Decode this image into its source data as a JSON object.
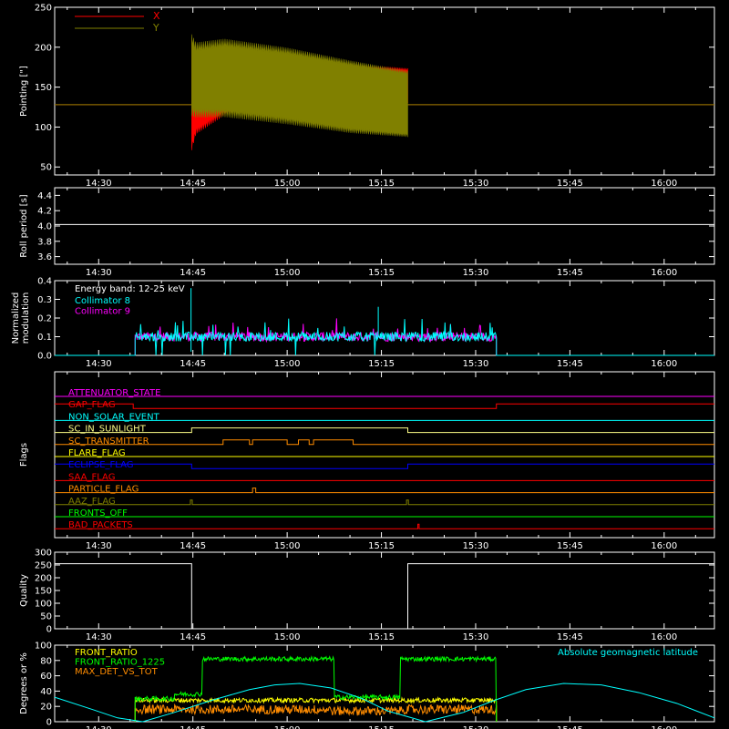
{
  "colors": {
    "bg": "#000000",
    "axis": "#ffffff",
    "x": "#ff0000",
    "y": "#808000",
    "collimator8": "#00ffff",
    "collimator9": "#ff00ff",
    "front_ratio": "#ffff00",
    "front_ratio_1225": "#00ff00",
    "max_det": "#ff8c00",
    "geomag": "#00ffff"
  },
  "time_ticks": [
    "14:30",
    "14:45",
    "15:00",
    "15:15",
    "15:30",
    "15:45",
    "16:00"
  ],
  "chart_data": [
    {
      "id": "pointing",
      "type": "area",
      "title": "",
      "xlabel": "",
      "ylabel": "Pointing [\"]",
      "xlim_min": [
        863,
        968
      ],
      "ylim": [
        40,
        250
      ],
      "yticks": [
        50,
        100,
        150,
        200,
        250
      ],
      "legend": "top-left",
      "series": [
        {
          "name": "X",
          "color": "#ff0000",
          "baseline": 128,
          "active_min": [
            884.8,
            919.2
          ],
          "envelope_min": [
            884.8,
            885.5,
            890,
            900,
            910,
            919.2
          ],
          "envelope_hi": [
            205,
            195,
            185,
            180,
            177,
            172
          ],
          "envelope_lo": [
            75,
            95,
            118,
            126,
            130,
            132
          ]
        },
        {
          "name": "Y",
          "color": "#808000",
          "baseline": 128,
          "active_min": [
            884.8,
            919.2
          ],
          "envelope_min": [
            884.8,
            885.5,
            890,
            900,
            910,
            919.2
          ],
          "envelope_hi": [
            210,
            200,
            205,
            195,
            180,
            168
          ],
          "envelope_lo": [
            120,
            118,
            118,
            108,
            96,
            90
          ]
        }
      ]
    },
    {
      "id": "roll",
      "type": "line",
      "ylabel": "Roll period [s]",
      "ylim": [
        3.5,
        4.5
      ],
      "yticks": [
        3.6,
        3.8,
        4.0,
        4.2,
        4.4
      ],
      "series": [
        {
          "name": "",
          "color": "#ffffff",
          "value": 4.02
        }
      ]
    },
    {
      "id": "modulation",
      "type": "line",
      "ylabel": "Normalized modulation",
      "ylim": [
        0,
        0.4
      ],
      "yticks": [
        0.0,
        0.1,
        0.2,
        0.3,
        0.4
      ],
      "annotation": "Energy band: 12-25 keV",
      "legend": "top-left",
      "active_min": [
        875.8,
        933.3
      ],
      "series": [
        {
          "name": "Collimator 8",
          "color": "#00ffff",
          "level": 0.1
        },
        {
          "name": "Collimator 9",
          "color": "#ff00ff",
          "level": 0.1
        }
      ]
    },
    {
      "id": "flags",
      "type": "line",
      "ylabel": "Flags",
      "series": [
        {
          "name": "ATTENUATOR_STATE",
          "color": "#ff00ff",
          "segments": []
        },
        {
          "name": "GAP_FLAG",
          "color": "#ff0000",
          "segments": [
            [
              863,
              875.5
            ],
            [
              933.3,
              968
            ]
          ]
        },
        {
          "name": "NON_SOLAR_EVENT",
          "color": "#00ffff",
          "segments": []
        },
        {
          "name": "SC_IN_SUNLIGHT",
          "color": "#ffff88",
          "segments": [
            [
              884.8,
              919.2
            ]
          ]
        },
        {
          "name": "SC_TRANSMITTER",
          "color": "#ff8c00",
          "segments": [
            [
              889.8,
              894.0
            ],
            [
              894.5,
              900.0
            ],
            [
              901.8,
              903.5
            ],
            [
              904.2,
              910.5
            ]
          ]
        },
        {
          "name": "FLARE_FLAG",
          "color": "#ffff00",
          "segments": []
        },
        {
          "name": "ECLIPSE_FLAG",
          "color": "#0000ff",
          "segments": [
            [
              863,
              884.8
            ],
            [
              919.2,
              968
            ]
          ]
        },
        {
          "name": "SAA_FLAG",
          "color": "#ff0000",
          "segments": []
        },
        {
          "name": "PARTICLE_FLAG",
          "color": "#ff8c00",
          "segments": [
            [
              894.5,
              895.0
            ]
          ]
        },
        {
          "name": "AAZ_FLAG",
          "color": "#808000",
          "segments": [
            [
              884.6,
              884.9
            ],
            [
              919.0,
              919.3
            ]
          ]
        },
        {
          "name": "FRONTS_OFF",
          "color": "#00ff00",
          "segments": []
        },
        {
          "name": "BAD_PACKETS",
          "color": "#ff0000",
          "segments": [
            [
              920.8,
              921.0
            ]
          ]
        }
      ]
    },
    {
      "id": "quality",
      "type": "line",
      "ylabel": "Quality",
      "ylim": [
        0,
        300
      ],
      "yticks": [
        0,
        50,
        100,
        150,
        200,
        250,
        300
      ],
      "series": [
        {
          "name": "",
          "color": "#ffffff",
          "high": 255,
          "segments": [
            [
              863,
              884.8
            ],
            [
              919.2,
              968
            ]
          ]
        }
      ]
    },
    {
      "id": "ratios",
      "type": "line",
      "ylabel": "Degrees or %",
      "ylim": [
        0,
        100
      ],
      "yticks": [
        0,
        20,
        40,
        60,
        80,
        100
      ],
      "legend": "top-left",
      "series": [
        {
          "name": "FRONT_RATIO",
          "color": "#ffff00",
          "active_min": [
            875.8,
            933.3
          ],
          "level": 28
        },
        {
          "name": "FRONT_RATIO_1225",
          "color": "#00ff00",
          "active_min": [
            875.8,
            933.3
          ],
          "steps": [
            [
              875.8,
              30
            ],
            [
              882,
              36
            ],
            [
              886.5,
              82
            ],
            [
              907.5,
              32
            ],
            [
              918,
              82
            ],
            [
              933.3,
              0
            ]
          ]
        },
        {
          "name": "MAX_DET_VS_TOT",
          "color": "#ff8c00",
          "active_min": [
            875.8,
            933.3
          ],
          "level": 16
        },
        {
          "name": "Absolute geomagnetic latitude",
          "color": "#00ffff",
          "legend_position": "top-right",
          "x_min": [
            863,
            869,
            873,
            877,
            882,
            888,
            894,
            898,
            902,
            907,
            912,
            916,
            922,
            928,
            933,
            938,
            944,
            950,
            956,
            962,
            968
          ],
          "y": [
            32,
            16,
            5,
            0,
            12,
            28,
            42,
            48,
            50,
            44,
            30,
            14,
            0,
            12,
            28,
            42,
            50,
            48,
            38,
            24,
            5
          ]
        }
      ]
    }
  ]
}
